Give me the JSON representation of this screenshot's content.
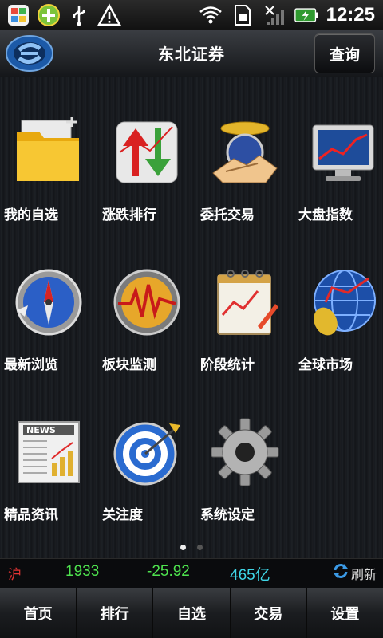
{
  "status_bar": {
    "time": "12:25"
  },
  "header": {
    "title": "东北证券",
    "query_label": "查询"
  },
  "grid": [
    {
      "label": "我的自选",
      "icon": "folder-icon"
    },
    {
      "label": "涨跌排行",
      "icon": "updown-arrows-icon"
    },
    {
      "label": "委托交易",
      "icon": "handshake-icon"
    },
    {
      "label": "大盘指数",
      "icon": "monitor-chart-icon"
    },
    {
      "label": "最新浏览",
      "icon": "compass-icon"
    },
    {
      "label": "板块监测",
      "icon": "pulse-gauge-icon"
    },
    {
      "label": "阶段统计",
      "icon": "notepad-chart-icon"
    },
    {
      "label": "全球市场",
      "icon": "globe-icon"
    },
    {
      "label": "精品资讯",
      "icon": "newspaper-icon"
    },
    {
      "label": "关注度",
      "icon": "target-icon"
    },
    {
      "label": "系统设定",
      "icon": "gear-icon"
    }
  ],
  "page_indicator": {
    "current": 1,
    "total": 2
  },
  "ticker": {
    "market": "沪",
    "index": "1933",
    "change": "-25.92",
    "volume": "465亿",
    "refresh_label": "刷新"
  },
  "tabs": [
    {
      "label": "首页"
    },
    {
      "label": "排行"
    },
    {
      "label": "自选"
    },
    {
      "label": "交易"
    },
    {
      "label": "设置"
    }
  ],
  "colors": {
    "market": "#e23333",
    "index": "#4ee24e",
    "change": "#4ee24e",
    "volume": "#3fd6e6",
    "accent": "#2a7ad6"
  }
}
